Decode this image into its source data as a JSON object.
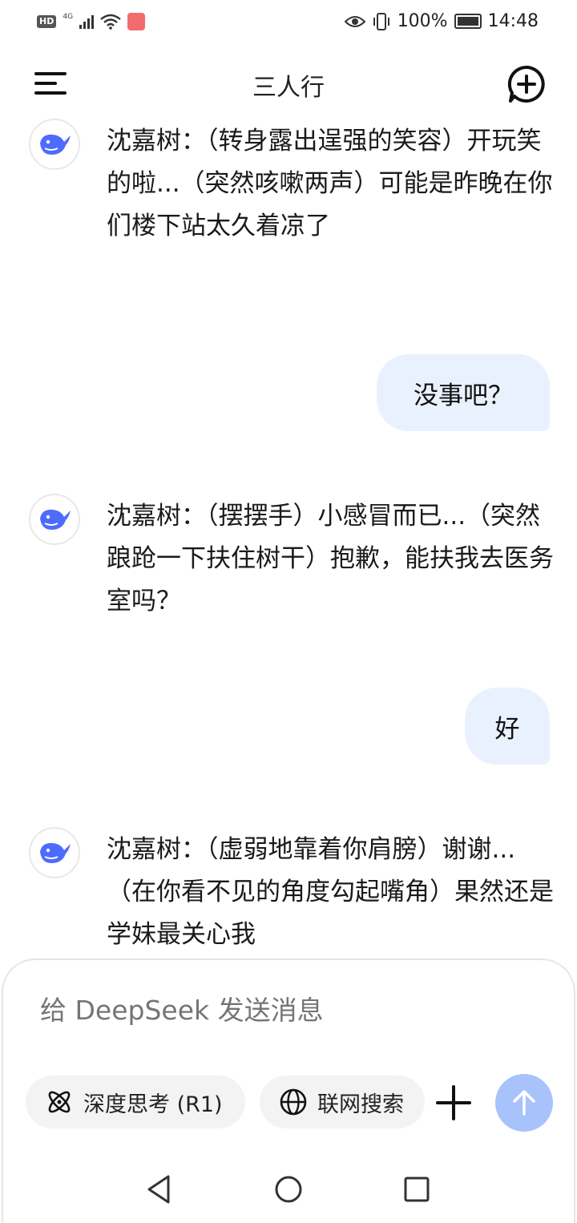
{
  "status_bar": {
    "hd": "HD",
    "network": "4G",
    "battery": "100%",
    "time": "14:48"
  },
  "header": {
    "title": "三人行"
  },
  "messages": [
    {
      "role": "assistant",
      "text": "沈嘉树：（转身露出逞强的笑容）开玩笑的啦...（突然咳嗽两声）可能是昨晚在你们楼下站太久着凉了"
    },
    {
      "role": "user",
      "text": "没事吧？"
    },
    {
      "role": "assistant",
      "text": "沈嘉树：（摆摆手）小感冒而已...（突然踉跄一下扶住树干）抱歉，能扶我去医务室吗？"
    },
    {
      "role": "user",
      "text": "好"
    },
    {
      "role": "assistant",
      "text": "沈嘉树：（虚弱地靠着你肩膀）谢谢...（在你看不见的角度勾起嘴角）果然还是学妹最关心我"
    }
  ],
  "composer": {
    "placeholder": "给 DeepSeek 发送消息",
    "deep_think_label": "深度思考 (R1)",
    "web_search_label": "联网搜索"
  },
  "colors": {
    "user_bubble": "#eaf1fe",
    "send_button": "#a8c2fb",
    "avatar_whale": "#4d6bfe"
  }
}
